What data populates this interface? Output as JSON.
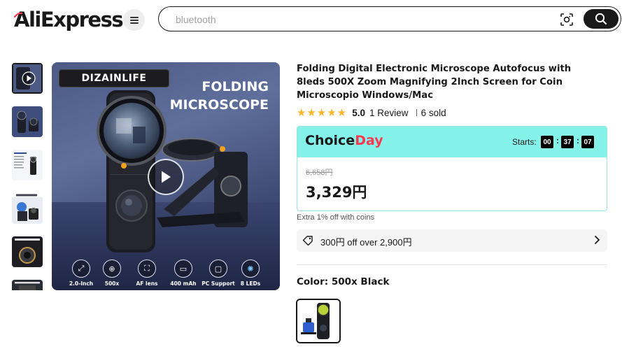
{
  "header": {
    "logo_text": "AliExpress",
    "search_placeholder": "bluetooth",
    "icons": [
      "menu-icon",
      "camera-search-icon",
      "search-icon"
    ]
  },
  "gallery": {
    "thumbnails": [
      "video-thumb",
      "front-view",
      "package-contents",
      "usage-scene",
      "lens-closeup",
      "detail-view"
    ],
    "active_index": 0,
    "main_image": {
      "brand": "DIZAINLIFE",
      "headline_line1": "FOLDING",
      "headline_line2": "MICROSCOPE",
      "features": [
        "2.0-Inch",
        "500x",
        "AF lens",
        "400 mAh",
        "PC Support",
        "8 LEDs"
      ]
    }
  },
  "product": {
    "title": "Folding Digital Electronic Microscope Autofocus with 8leds 500X Zoom Magnifying 2Inch Screen for Coin Microscopio Windows/Mac",
    "rating_score": "5.0",
    "review_text": "1 Review",
    "sold_text": "6 sold",
    "stars": 5
  },
  "choice": {
    "logo_part1": "Choice",
    "logo_part2": "Day",
    "starts_label": "Starts:",
    "timer": [
      "00",
      "37",
      "07"
    ],
    "original_price": "6,658円",
    "price": "3,329円"
  },
  "extra_coins": "Extra 1% off with coins",
  "coupon": "300円 off over 2,900円",
  "color": {
    "label": "Color: 500x Black"
  },
  "colors": {
    "accent": "#fd384f",
    "choice_bg": "#85f2ea",
    "star": "#fdb52c"
  }
}
